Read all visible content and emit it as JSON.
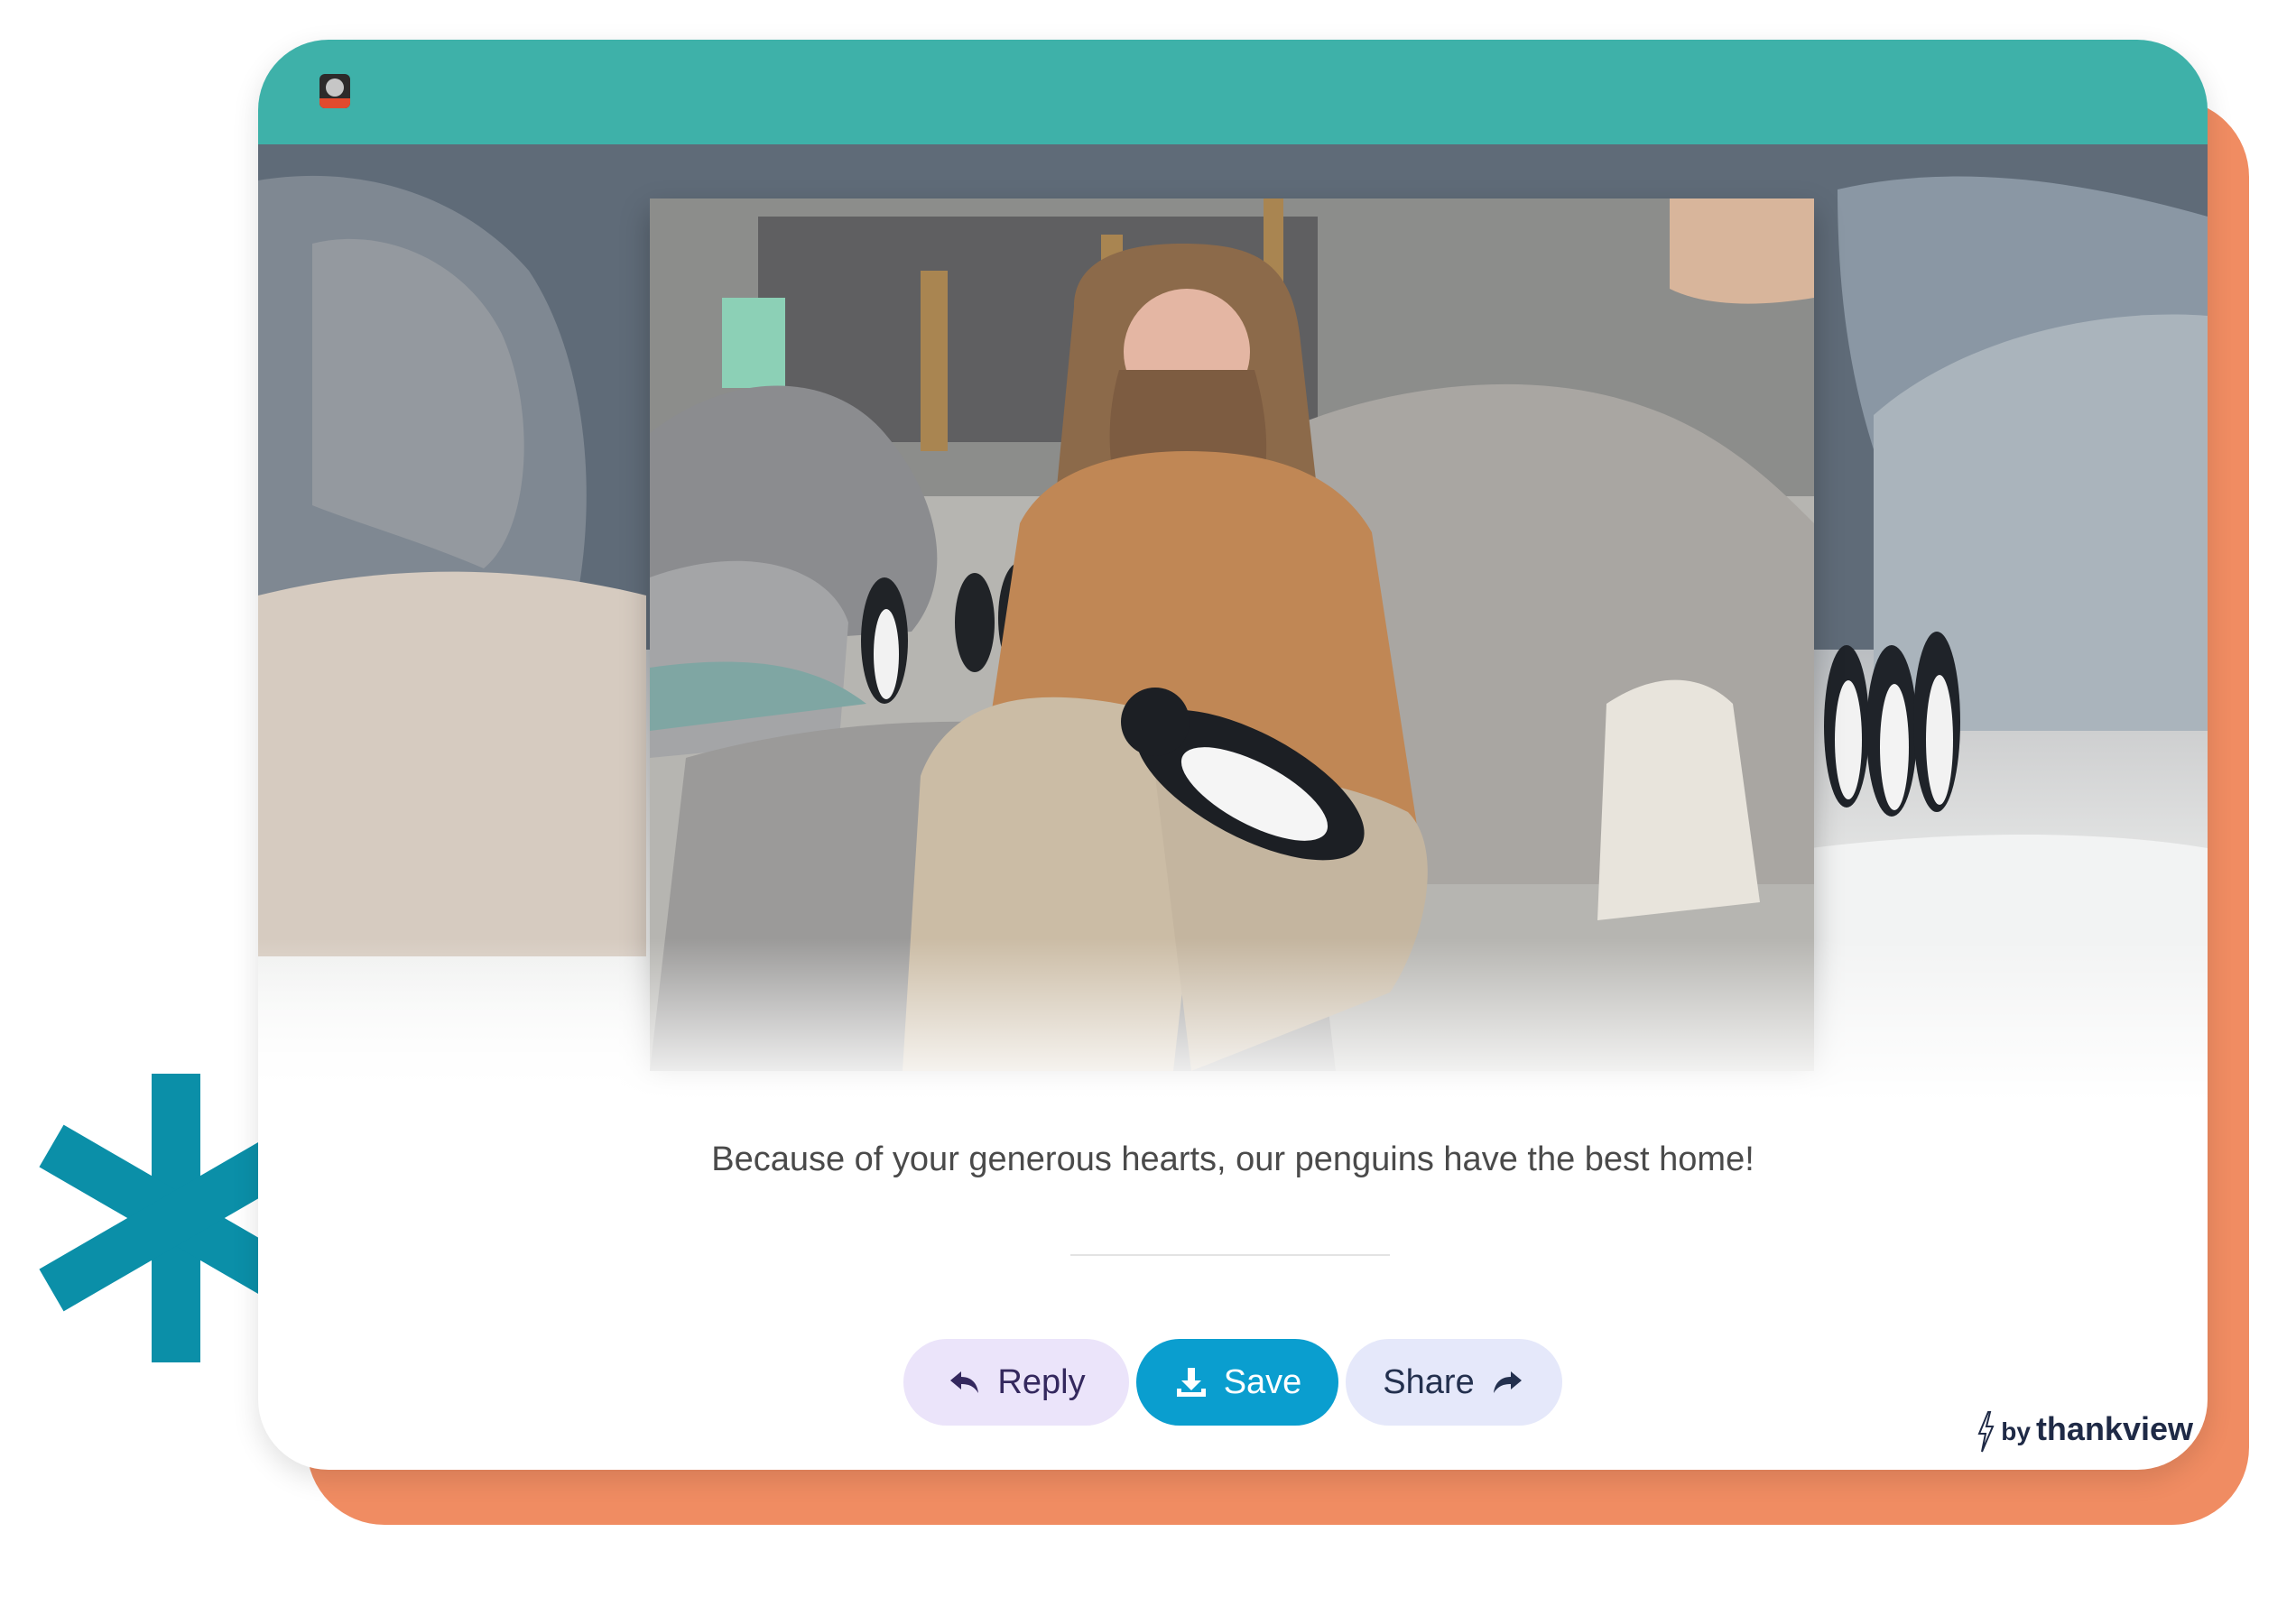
{
  "message": {
    "caption": "Because of your generous hearts, our penguins have the best home!"
  },
  "actions": {
    "reply_label": "Reply",
    "save_label": "Save",
    "share_label": "Share"
  },
  "branding": {
    "by": "by",
    "name": "thankview"
  },
  "icons": {
    "reply": "reply-arrow-icon",
    "save": "download-icon",
    "share": "share-arrow-icon",
    "brand": "lightning-bolt-icon",
    "logo": "zoo-logo-icon",
    "decoration": "asterisk-decoration"
  },
  "colors": {
    "header_bar": "#3eb1a9",
    "backer": "#f08c62",
    "asterisk": "#0b8fa8",
    "save_button": "#0a9ecf",
    "reply_button": "#ebe4fa",
    "share_button": "#e5e8fa",
    "brand_text": "#1f2a46"
  }
}
